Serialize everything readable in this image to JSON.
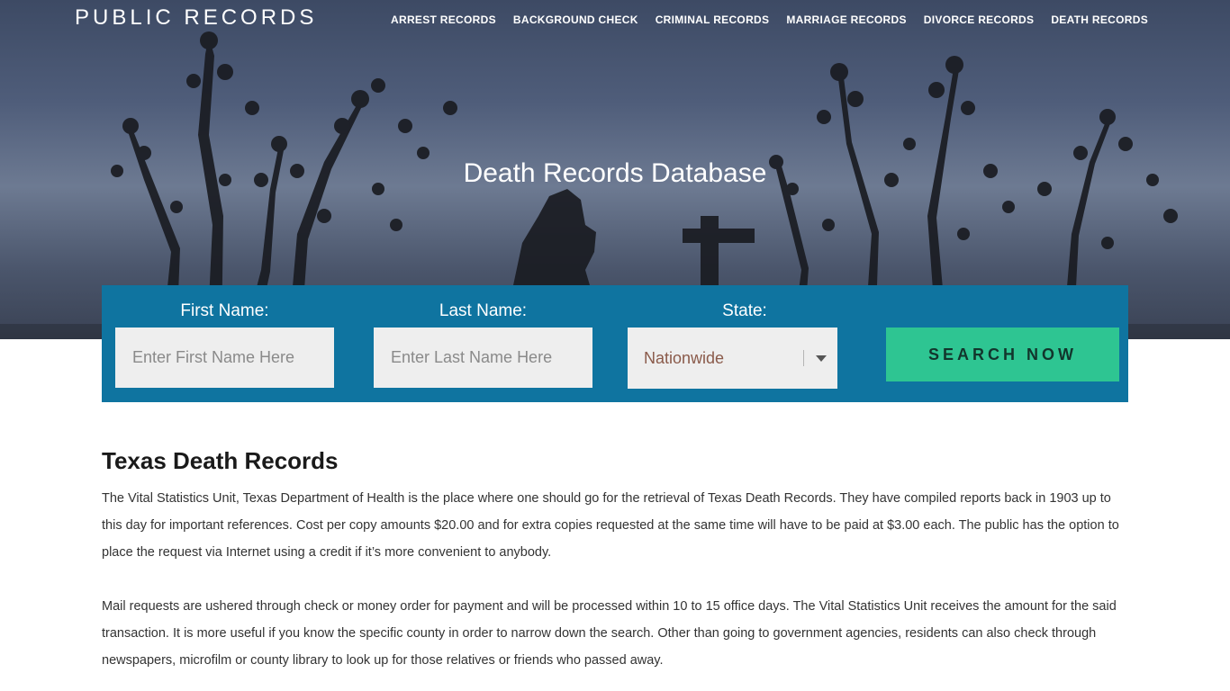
{
  "brand": "PUBLIC RECORDS",
  "nav": [
    "ARREST RECORDS",
    "BACKGROUND CHECK",
    "CRIMINAL RECORDS",
    "MARRIAGE RECORDS",
    "DIVORCE RECORDS",
    "DEATH RECORDS"
  ],
  "hero_title": "Death Records Database",
  "search": {
    "first_name_label": "First Name:",
    "first_name_placeholder": "Enter First Name Here",
    "last_name_label": "Last Name:",
    "last_name_placeholder": "Enter Last Name Here",
    "state_label": "State:",
    "state_value": "Nationwide",
    "button_label": "SEARCH NOW"
  },
  "article": {
    "heading": "Texas Death Records",
    "paragraphs": [
      "The Vital Statistics Unit, Texas Department of Health is the place where one should go for the retrieval of Texas Death Records. They have compiled reports back in 1903 up to this day for important references. Cost per copy amounts $20.00 and for extra copies requested at the same time will have to be paid at $3.00 each. The public has the option to place the request via Internet using a credit if it’s more convenient to anybody.",
      "Mail requests are ushered through check or money order for payment and will be processed within 10 to 15 office days. The Vital Statistics Unit receives the amount for the said transaction. It is more useful if you know the specific county in order to narrow down the search. Other than going to government agencies, residents can also check through newspapers, microfilm or county library to look up for those relatives or friends who passed away."
    ]
  },
  "colors": {
    "search_panel": "#0f74a0",
    "search_button": "#2ec592",
    "field_bg": "#eeeeee"
  },
  "icons": {
    "state_dropdown": "chevron-down-icon"
  }
}
